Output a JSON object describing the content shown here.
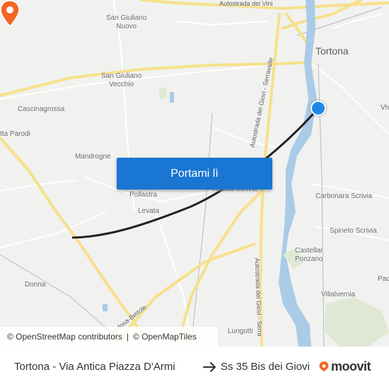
{
  "map": {
    "places": {
      "tortona": "Tortona",
      "san_giuliano_nuovo": "San Giuliano\nNuovo",
      "san_giuliano_vecchio": "San Giuliano\nVecchio",
      "cascinagrossa": "Cascinagrossa",
      "villa_parodi": "tta Parodi",
      "mandrogne": "Mandrogne",
      "pollastra": "Pollastra",
      "levata": "Levata",
      "rivalta_scrivia": "Rivalta Scrivia",
      "carbonara_scrivia": "Carbonara Scrivia",
      "spineto_scrivia": "Spineto Scrivia",
      "castellar_ponzano": "Castellar\nPonzano",
      "villalvernia": "Villalvernia",
      "donna": "Donna",
      "lungotti": "Lungotti",
      "vh": "Vh",
      "pac": "Pac"
    },
    "roads": {
      "autostrada_vini": "Autostrada dei Vini",
      "autostrada_giovi_serravalle": "Autostrada dei Giovi - Serravalle",
      "autostrada_giovi_serra_south": "Autostrada dei Giovi - Serra",
      "predosa_bettole": "Predosa-Bettole"
    },
    "colors": {
      "land": "#f1f1ef",
      "water": "#a9cbe8",
      "highway": "#f7e08a",
      "route": "#222222",
      "origin": "#1e88e5",
      "destination": "#f26522"
    }
  },
  "cta": {
    "label": "Portami lì"
  },
  "attribution": {
    "osm_contributors": "© OpenStreetMap contributors",
    "openmaptiles": "© OpenMapTiles"
  },
  "footer": {
    "origin": "Tortona - Via Antica Piazza D'Armi",
    "destination": "Ss 35 Bis dei Giovi",
    "brand": "moovit"
  }
}
